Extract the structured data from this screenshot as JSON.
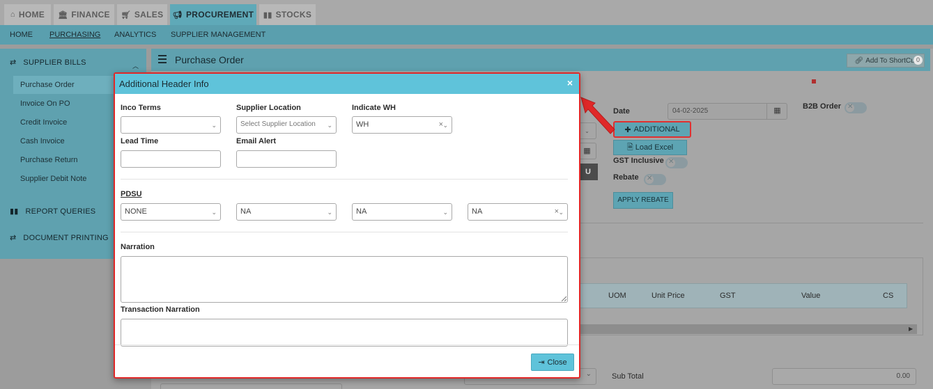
{
  "top_tabs": [
    {
      "label": "HOME",
      "icon": "home-icon"
    },
    {
      "label": "FINANCE",
      "icon": "bank-icon"
    },
    {
      "label": "SALES",
      "icon": "cart-icon"
    },
    {
      "label": "PROCUREMENT",
      "icon": "megaphone-icon"
    },
    {
      "label": "STOCKS",
      "icon": "bar-chart-icon"
    }
  ],
  "sub_nav": [
    "HOME",
    "PURCHASING",
    "ANALYTICS",
    "SUPPLIER MANAGEMENT"
  ],
  "sidebar": {
    "sections": [
      {
        "label": "SUPPLIER BILLS",
        "icon": "exchange-icon"
      },
      {
        "label": "REPORT QUERIES",
        "icon": "bar-chart-icon"
      },
      {
        "label": "DOCUMENT PRINTING",
        "icon": "exchange-icon"
      }
    ],
    "items": [
      "Purchase Order",
      "Invoice On PO",
      "Credit Invoice",
      "Cash Invoice",
      "Purchase Return",
      "Supplier Debit Note"
    ]
  },
  "main": {
    "title": "Purchase Order",
    "shortcut_label": "Add To ShortCut",
    "shortcut_count": "0",
    "date_label": "Date",
    "date_value": "04-02-2025",
    "b2b_label": "B2B Order",
    "additional_label": "ADDITIONAL",
    "load_excel_label": "Load Excel",
    "gst_label": "GST Inclusive",
    "rebate_label": "Rebate",
    "apply_rebate_label": "APPLY REBATE",
    "u_label": "U",
    "grid_columns": [
      "UOM",
      "Unit Price",
      "GST",
      "Value",
      "CS"
    ],
    "sub_total_label": "Sub Total",
    "sub_total_value": "0.00"
  },
  "modal": {
    "title": "Additional Header Info",
    "inco_terms_label": "Inco Terms",
    "inco_terms_value": "",
    "supplier_location_label": "Supplier Location",
    "supplier_location_placeholder": "Select Supplier Location",
    "indicate_wh_label": "Indicate WH",
    "indicate_wh_value": "WH",
    "lead_time_label": "Lead Time",
    "email_alert_label": "Email Alert",
    "pdsu_label": "PDSU",
    "pdsu_values": [
      "NONE",
      "NA",
      "NA",
      "NA"
    ],
    "narration_label": "Narration",
    "transaction_narration_label": "Transaction Narration",
    "close_label": "Close"
  }
}
